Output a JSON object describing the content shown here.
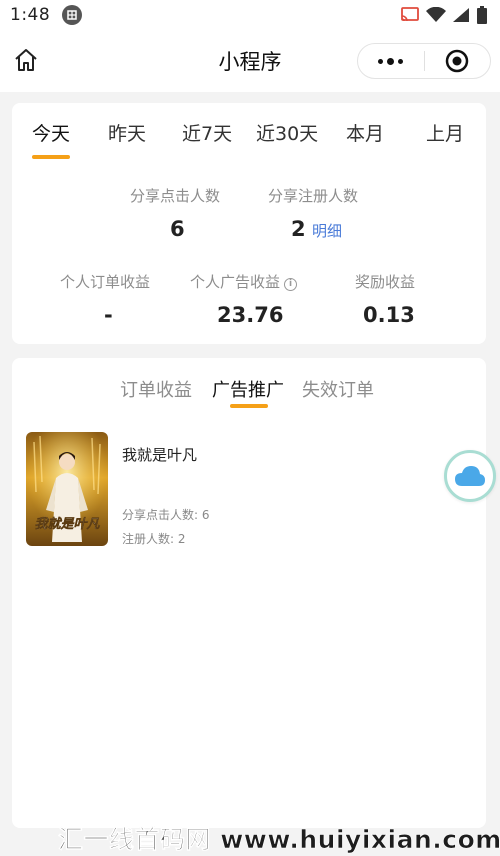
{
  "status_bar": {
    "time": "1:48",
    "icons": [
      "app-icon",
      "cast-icon",
      "wifi-icon",
      "signal-icon",
      "battery-icon"
    ]
  },
  "nav": {
    "title": "小程序",
    "home_icon": "home-icon",
    "more_icon": "more-dots-icon",
    "close_icon": "target-close-icon"
  },
  "period_tabs": [
    {
      "label": "今天",
      "active": true
    },
    {
      "label": "昨天"
    },
    {
      "label": "近7天"
    },
    {
      "label": "近30天"
    },
    {
      "label": "本月"
    },
    {
      "label": "上月"
    }
  ],
  "stats": {
    "share_clicks": {
      "label": "分享点击人数",
      "value": "6"
    },
    "share_registers": {
      "label": "分享注册人数",
      "value": "2",
      "link": "明细"
    },
    "order_income": {
      "label": "个人订单收益",
      "value": "-"
    },
    "ad_income": {
      "label": "个人广告收益",
      "value": "23.76",
      "info_icon": "ⓘ"
    },
    "reward_income": {
      "label": "奖励收益",
      "value": "0.13"
    }
  },
  "list_tabs": [
    {
      "label": "订单收益"
    },
    {
      "label": "广告推广",
      "active": true
    },
    {
      "label": "失效订单"
    }
  ],
  "items": [
    {
      "title": "我就是叶凡",
      "cover_text": "我就是叶凡",
      "share_clicks": "分享点击人数: 6",
      "registers": "注册人数: 2"
    }
  ],
  "floating": {
    "icon": "cloud-icon"
  },
  "watermark": "汇一线首码网 www.huiyixian.com",
  "colors": {
    "accent": "#f5a017",
    "link": "#4a7bd8",
    "cloud": "#4aa8e8"
  }
}
